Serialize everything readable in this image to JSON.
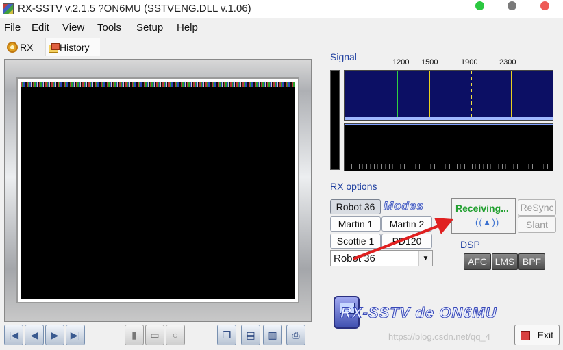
{
  "window": {
    "title": "RX-SSTV v.2.1.5 ?ON6MU (SSTVENG.DLL v.1.06)"
  },
  "menu": [
    "File",
    "Edit",
    "View",
    "Tools",
    "Setup",
    "Help"
  ],
  "toolbar": {
    "rx_label": "RX",
    "history_label": "History"
  },
  "signal": {
    "label": "Signal",
    "frequencies": [
      "1200",
      "1500",
      "1900",
      "2300"
    ]
  },
  "rx_options": {
    "label": "RX options",
    "modes_logo": "Modes",
    "buttons": [
      "Robot 36",
      "Martin 1",
      "Martin 2",
      "Scottie 1",
      "PD120"
    ],
    "selected_mode": "Robot 36"
  },
  "status": {
    "text": "Receiving...",
    "icon": "((▲))"
  },
  "sync": {
    "resync": "ReSync",
    "slant": "Slant"
  },
  "dsp": {
    "label": "DSP",
    "afc": "AFC",
    "lms": "LMS",
    "bpf": "BPF"
  },
  "logo": {
    "text": "RX-SSTV de ON6MU"
  },
  "watermark": "https://blog.csdn.net/qq_4",
  "exit_label": "Exit",
  "colors": {
    "accent_blue": "#2040a0",
    "receiving_green": "#22a030",
    "spectrum_bg": "#0c0f64"
  }
}
